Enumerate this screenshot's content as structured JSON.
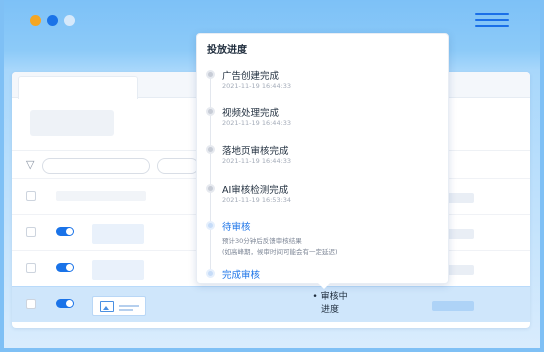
{
  "colors": {
    "accent": "#1a73e8",
    "dot_orange": "#f5a623",
    "dot_blue": "#1a73e8",
    "row_selected": "#cfe6fb"
  },
  "icons": {
    "filter": "funnel-icon",
    "menu": "hamburger-menu-icon",
    "thumbnail": "image-icon"
  },
  "table": {
    "selected_row": {
      "status_label": "• 审核中",
      "progress_link": "进度"
    }
  },
  "popover": {
    "title": "投放进度",
    "steps": [
      {
        "title": "广告创建完成",
        "time": "2021-11-19 16:44:33",
        "state": "done"
      },
      {
        "title": "视频处理完成",
        "time": "2021-11-19 16:44:33",
        "state": "done"
      },
      {
        "title": "落地页审核完成",
        "time": "2021-11-19 16:44:33",
        "state": "done"
      },
      {
        "title": "AI审核检测完成",
        "time": "2021-11-19 16:53:34",
        "state": "done"
      },
      {
        "title": "待审核",
        "desc1": "预计30分钟后反馈审核结果",
        "desc2": "(如高峰期，候审时间可能会有一定延迟)",
        "state": "current"
      },
      {
        "title": "完成审核",
        "state": "pending"
      }
    ]
  }
}
